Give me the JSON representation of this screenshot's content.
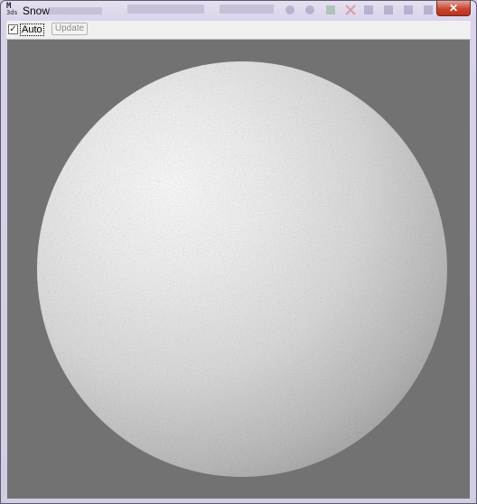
{
  "window": {
    "title": "Snow",
    "close_glyph": "✕"
  },
  "app_icon": {
    "line1": "M",
    "line2": "3ds"
  },
  "toolbar": {
    "auto_checkbox": {
      "label": "Auto",
      "checked": true,
      "check_glyph": "✓"
    },
    "update_label": "Update",
    "update_enabled": false
  },
  "viewport": {
    "background": "#727272",
    "object": "snow-textured sphere"
  },
  "colors": {
    "close_button": "#c8452f",
    "titlebar": "#d9d2ea"
  }
}
